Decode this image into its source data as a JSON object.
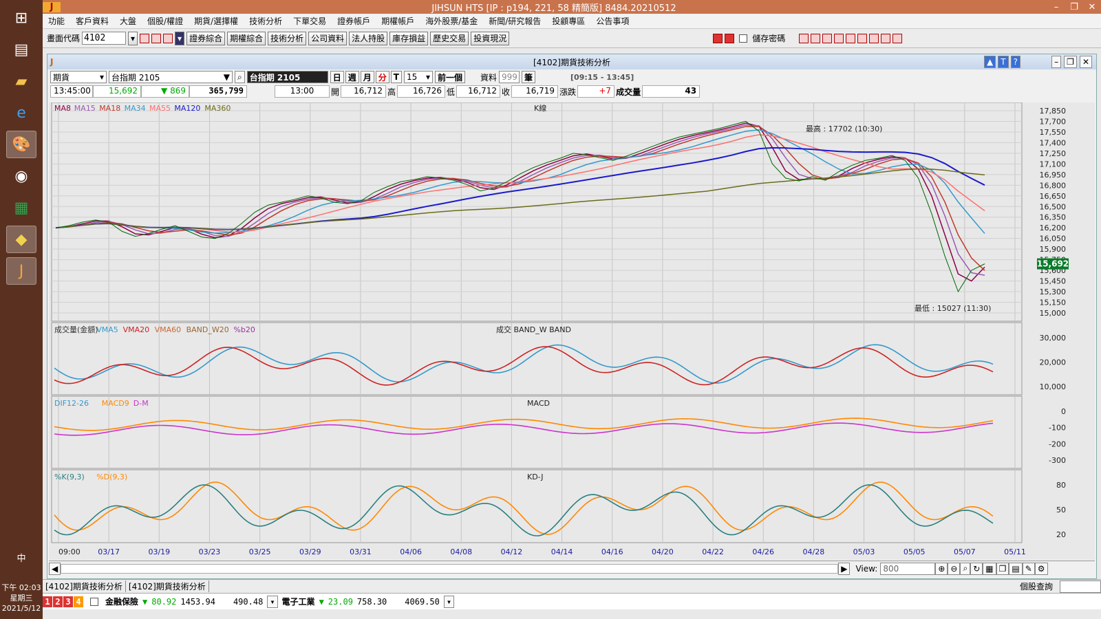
{
  "taskbar": {
    "icons": [
      "windows-icon",
      "app-icon",
      "folder-icon",
      "ie-icon",
      "paint-icon",
      "chrome-icon",
      "sheet-icon",
      "map-icon",
      "hts-icon"
    ],
    "time": "下午 02:03",
    "weekday": "星期三",
    "date": "2021/5/12",
    "ime": "中"
  },
  "window": {
    "title": "JIHSUN HTS      [IP : p194, 221, 58 精簡版] 8484.20210512"
  },
  "menu": [
    "功能",
    "客戶資料",
    "大盤",
    "個股/權證",
    "期貨/選擇權",
    "技術分析",
    "下單交易",
    "證券帳戶",
    "期權帳戶",
    "海外股票/基金",
    "新聞/研究報告",
    "投顧專區",
    "公告事項"
  ],
  "toolbar": {
    "code_label": "畫面代碼",
    "code_value": "4102",
    "buttons": [
      "證券綜合",
      "期權綜合",
      "技術分析",
      "公司資料",
      "法人持股",
      "庫存損益",
      "歷史交易",
      "投資現況"
    ],
    "save_pw": "儲存密碼"
  },
  "panel": {
    "title": "[4102]期貨技術分析",
    "market": "期貨",
    "symbol_select": "台指期 2105",
    "symbol_name": "台指期 2105",
    "periods": [
      "日",
      "週",
      "月",
      "分",
      "T"
    ],
    "interval": "15",
    "prev_btn": "前一個",
    "data_label": "資料",
    "data_count": "999",
    "data_unit": "筆",
    "session": "[09:15 - 13:45]"
  },
  "quote": {
    "time": "13:45:00",
    "last": "15,692",
    "change": "869",
    "volume_total": "365,799",
    "bar_time": "13:00",
    "open_label": "開",
    "open": "16,712",
    "high_label": "高",
    "high": "16,726",
    "low_label": "低",
    "low": "16,712",
    "close_label": "收",
    "close": "16,719",
    "chg_label": "漲跌",
    "chg": "+7",
    "vol_label": "成交量",
    "vol": "43"
  },
  "chart_data": [
    {
      "type": "line",
      "title": "K線",
      "legend": [
        "MA8",
        "MA15",
        "MA18",
        "MA34",
        "MA55",
        "MA120",
        "MA360"
      ],
      "colors": {
        "MA8": "#8b0047",
        "MA15": "#9b59b6",
        "MA18": "#c0392b",
        "MA34": "#3399cc",
        "MA55": "#ff6f6f",
        "MA120": "#1a1acc",
        "MA360": "#6b6b1a"
      },
      "ylim": [
        15000,
        17850
      ],
      "yticks": [
        "17,850",
        "17,700",
        "17,550",
        "17,400",
        "17,250",
        "17,100",
        "16,950",
        "16,800",
        "16,650",
        "16,500",
        "16,350",
        "16,200",
        "16,050",
        "15,900",
        "15,750",
        "15,600",
        "15,450",
        "15,300",
        "15,150",
        "15,000"
      ],
      "last_price": "15,692",
      "annotations": {
        "high": "最高 : 17702 (10:30)",
        "low": "最低 : 15027 (11:30)"
      },
      "x_labels": [
        "09:00",
        "03/17",
        "03/19",
        "03/23",
        "03/25",
        "03/29",
        "03/31",
        "04/06",
        "04/08",
        "04/12",
        "04/14",
        "04/16",
        "04/20",
        "04/22",
        "04/26",
        "04/28",
        "05/03",
        "05/05",
        "05/07",
        "05/11"
      ],
      "price_path": [
        16200,
        16230,
        16280,
        16310,
        16280,
        16150,
        16080,
        16120,
        16180,
        16230,
        16150,
        16070,
        16050,
        16120,
        16260,
        16420,
        16520,
        16560,
        16600,
        16650,
        16620,
        16560,
        16540,
        16580,
        16700,
        16780,
        16850,
        16880,
        16920,
        16900,
        16870,
        16810,
        16720,
        16760,
        16850,
        16960,
        17050,
        17120,
        17180,
        17250,
        17230,
        17190,
        17150,
        17210,
        17280,
        17350,
        17420,
        17480,
        17520,
        17560,
        17600,
        17650,
        17700,
        17560,
        17100,
        16900,
        16860,
        16920,
        16870,
        16990,
        17080,
        17150,
        17180,
        17220,
        17150,
        16900,
        16400,
        15800,
        15300,
        15600,
        15692
      ]
    },
    {
      "type": "line",
      "title": "成交 BAND_W BAND",
      "legend": [
        "成交量(金額)",
        "VMA5",
        "VMA20",
        "VMA60",
        "BAND_W20",
        "%b20"
      ],
      "colors": {
        "成交量(金額)": "#333",
        "VMA5": "#3399cc",
        "VMA20": "#cc2222",
        "VMA60": "#cc6633",
        "BAND_W20": "#996633",
        "%b20": "#993399"
      },
      "yticks": [
        "30,000",
        "20,000",
        "10,000"
      ]
    },
    {
      "type": "line",
      "title": "MACD",
      "legend": [
        "DIF12-26",
        "MACD9",
        "D-M"
      ],
      "colors": {
        "DIF12-26": "#3399cc",
        "MACD9": "#ff8800",
        "D-M": "#cc33cc"
      },
      "yticks": [
        "0",
        "-100",
        "-200",
        "-300"
      ]
    },
    {
      "type": "line",
      "title": "KD-J",
      "legend": [
        "%K(9,3)",
        "%D(9,3)"
      ],
      "colors": {
        "%K(9,3)": "#2a7f7f",
        "%D(9,3)": "#ff8800"
      },
      "yticks": [
        "80",
        "50",
        "20"
      ]
    }
  ],
  "scroll": {
    "view_label": "View:",
    "view_value": "800"
  },
  "tabs": [
    "[4102]期貨技術分析",
    "[4102]期貨技術分析"
  ],
  "right_status": "個股查詢",
  "ticker": {
    "nums": [
      "1",
      "2",
      "3",
      "4"
    ],
    "item1": "金融保險",
    "item1_arrow": "▼",
    "item1_chg": "80.92",
    "item1_price": "1453.94",
    "item1_vol": "490.48",
    "item2": "電子工業",
    "item2_arrow": "▼",
    "item2_chg": "23.09",
    "item2_price": "758.30",
    "item2_vol": "4069.50"
  }
}
